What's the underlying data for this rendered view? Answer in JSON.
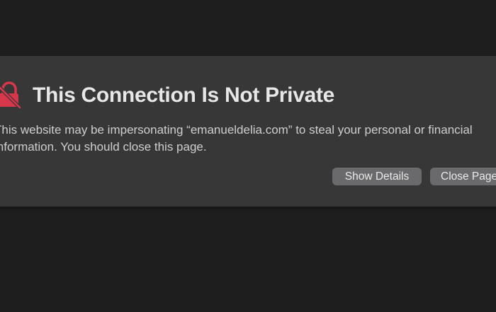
{
  "dialog": {
    "title": "This Connection Is Not Private",
    "message_line1": "This website may be impersonating “emanueldelia.com” to steal your personal or financial",
    "message_line2": "information. You should close this page.",
    "show_details_label": "Show Details",
    "close_page_label": "Close Page",
    "icon": "broken-lock-warning-icon"
  },
  "colors": {
    "background": "#1e1e1f",
    "panel": "#373738",
    "accent_warning": "#d8364a",
    "button": "#6a6a6c",
    "title_text": "#e7e7e7",
    "body_text": "#cfcfd0"
  }
}
